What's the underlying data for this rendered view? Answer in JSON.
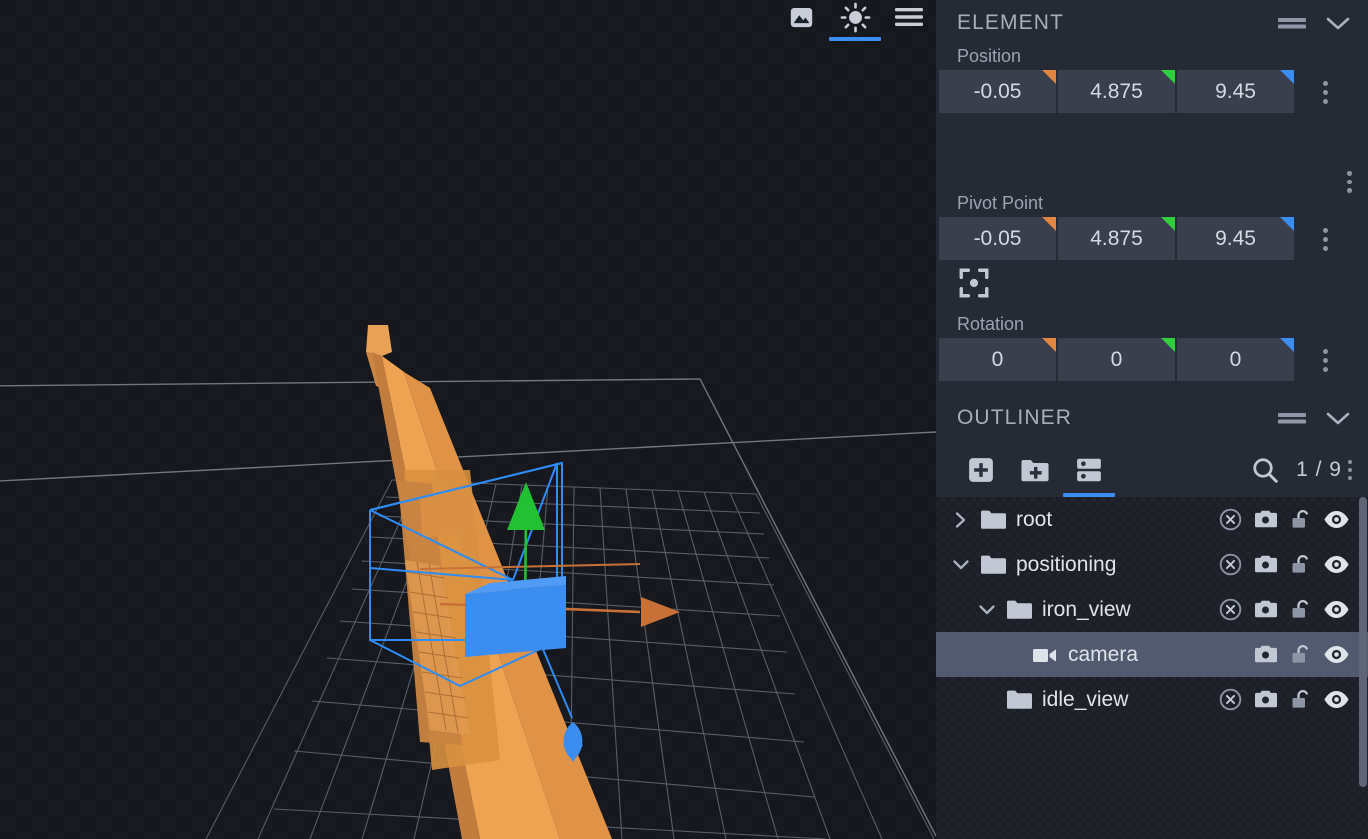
{
  "viewport": {
    "toolbar": [
      {
        "name": "image-icon",
        "label": "Image",
        "active": false
      },
      {
        "name": "light-icon",
        "label": "Light",
        "active": true
      },
      {
        "name": "menu-icon",
        "label": "Menu",
        "active": false
      }
    ],
    "gizmo": {
      "axis_x_color": "#c87137",
      "axis_y_color": "#22c033",
      "axis_z_color": "#3b8ef0",
      "selection_box_color": "#3b8ef0",
      "handle_box_color": "#3b8ef0"
    },
    "model_color": "#eda351",
    "grid_color": "#8e95a3",
    "background_color": "#15171d"
  },
  "element_panel": {
    "title": "ELEMENT",
    "position": {
      "label": "Position",
      "x": "-0.05",
      "y": "4.875",
      "z": "9.45"
    },
    "pivot": {
      "label": "Pivot Point",
      "x": "-0.05",
      "y": "4.875",
      "z": "9.45"
    },
    "rotation": {
      "label": "Rotation",
      "x": "0",
      "y": "0",
      "z": "0"
    },
    "axis_colors": {
      "x": "#e08640",
      "y": "#2fcf3d",
      "z": "#3b8ef0"
    }
  },
  "outliner": {
    "title": "OUTLINER",
    "tools": [
      {
        "name": "add-element-button",
        "label": "Add Element",
        "active": false
      },
      {
        "name": "add-group-button",
        "label": "Add Group",
        "active": false
      },
      {
        "name": "list-view-button",
        "label": "List View",
        "active": true
      }
    ],
    "search_label": "Search",
    "counter": "1 / 9",
    "rows": [
      {
        "label": "root",
        "indent": 0,
        "twist": "collapsed",
        "icon": "folder-icon",
        "selected": false,
        "icons": [
          "x-circle-icon",
          "camera-icon",
          "unlock-icon",
          "eye-icon"
        ]
      },
      {
        "label": "positioning",
        "indent": 0,
        "twist": "expanded",
        "icon": "folder-icon",
        "selected": false,
        "icons": [
          "x-circle-icon",
          "camera-icon",
          "unlock-icon",
          "eye-icon"
        ]
      },
      {
        "label": "iron_view",
        "indent": 1,
        "twist": "expanded",
        "icon": "folder-icon",
        "selected": false,
        "icons": [
          "x-circle-icon",
          "camera-icon",
          "unlock-icon",
          "eye-icon"
        ]
      },
      {
        "label": "camera",
        "indent": 2,
        "twist": "none",
        "icon": "video-camera-icon",
        "selected": true,
        "icons": [
          "camera-icon",
          "unlock-icon",
          "eye-icon"
        ]
      },
      {
        "label": "idle_view",
        "indent": 1,
        "twist": "none",
        "icon": "folder-icon",
        "selected": false,
        "icons": [
          "x-circle-icon",
          "camera-icon",
          "unlock-icon",
          "eye-icon"
        ]
      }
    ]
  },
  "theme": {
    "panel_bg": "#262a35",
    "tree_bg": "#1c1f27",
    "field_bg": "#393f4d",
    "accent": "#3b8ef0",
    "selected_row": "#515a6e",
    "text": "#dfe3ea",
    "muted_text": "#9ba3b2"
  }
}
